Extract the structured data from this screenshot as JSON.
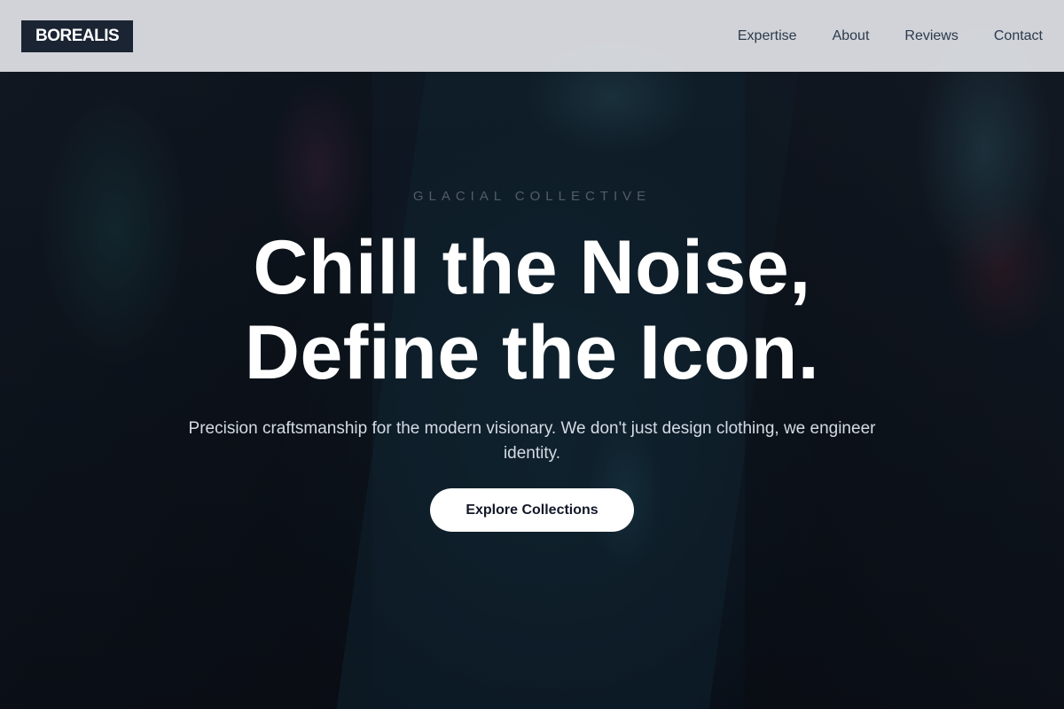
{
  "header": {
    "logo": "BOREALIS",
    "nav": [
      {
        "label": "Expertise"
      },
      {
        "label": "About"
      },
      {
        "label": "Reviews"
      },
      {
        "label": "Contact"
      }
    ]
  },
  "hero": {
    "eyebrow": "GLACIAL COLLECTIVE",
    "headline_line1": "Chill the Noise,",
    "headline_line2": "Define the Icon.",
    "subtext": "Precision craftsmanship for the modern visionary. We don't just design clothing, we engineer identity.",
    "cta_label": "Explore Collections"
  },
  "colors": {
    "header_bg": "#e2e4e8",
    "logo_bg": "#1b2433",
    "nav_text": "#2c3a4d",
    "cta_bg": "#ffffff",
    "cta_text": "#111827"
  }
}
